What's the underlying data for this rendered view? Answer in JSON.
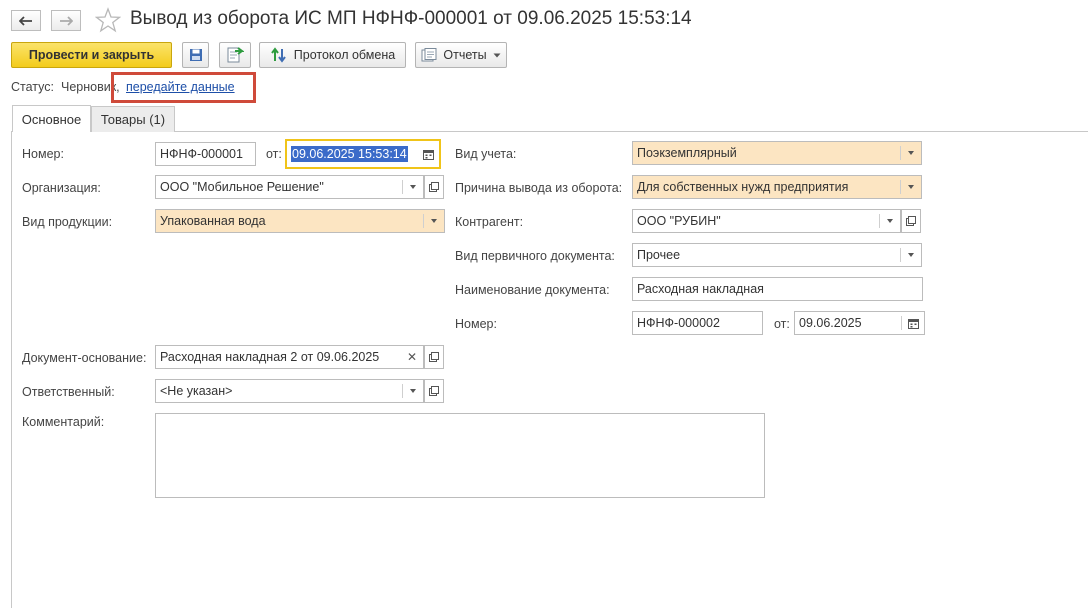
{
  "window": {
    "title": "Вывод из оборота ИС МП НФНФ-000001 от 09.06.2025 15:53:14"
  },
  "toolbar": {
    "post_close_label": "Провести и закрыть",
    "exchange_protocol_label": "Протокол обмена",
    "reports_label": "Отчеты"
  },
  "status": {
    "label": "Статус:",
    "value": "Черновик,",
    "link": "передайте данные"
  },
  "tabs": [
    {
      "label": "Основное",
      "active": true
    },
    {
      "label": "Товары (1)",
      "active": false
    }
  ],
  "form": {
    "number": {
      "label": "Номер:",
      "value": "НФНФ-000001"
    },
    "date": {
      "label": "от:",
      "value": "09.06.2025 15:53:14"
    },
    "organization": {
      "label": "Организация:",
      "value": "ООО \"Мобильное Решение\""
    },
    "product_type": {
      "label": "Вид продукции:",
      "value": "Упакованная вода"
    },
    "accounting_type": {
      "label": "Вид учета:",
      "value": "Поэкземплярный"
    },
    "withdrawal_reason": {
      "label": "Причина вывода из оборота:",
      "value": "Для собственных нужд предприятия"
    },
    "counterparty": {
      "label": "Контрагент:",
      "value": "ООО \"РУБИН\""
    },
    "primary_doc_type": {
      "label": "Вид первичного документа:",
      "value": "Прочее"
    },
    "doc_name": {
      "label": "Наименование документа:",
      "value": "Расходная накладная"
    },
    "primary_number": {
      "label": "Номер:",
      "value": "НФНФ-000002"
    },
    "primary_date": {
      "label": "от:",
      "value": "09.06.2025"
    },
    "base_document": {
      "label": "Документ-основание:",
      "value": "Расходная накладная 2 от 09.06.2025"
    },
    "responsible": {
      "label": "Ответственный:",
      "value": "<Не указан>"
    },
    "comment": {
      "label": "Комментарий:",
      "value": ""
    }
  },
  "colors": {
    "primary_button": "#f3cc1c",
    "highlight_field": "#fce5c2",
    "focus_border": "#f0c419",
    "annotation_box": "#cf4a3a",
    "link": "#1d4fa8"
  },
  "icons": [
    "back-arrow-icon",
    "forward-arrow-icon",
    "star-icon",
    "save-icon",
    "post-icon",
    "exchange-protocol-icon",
    "reports-icon",
    "calendar-icon",
    "chevron-down-icon",
    "open-icon",
    "clear-icon"
  ]
}
